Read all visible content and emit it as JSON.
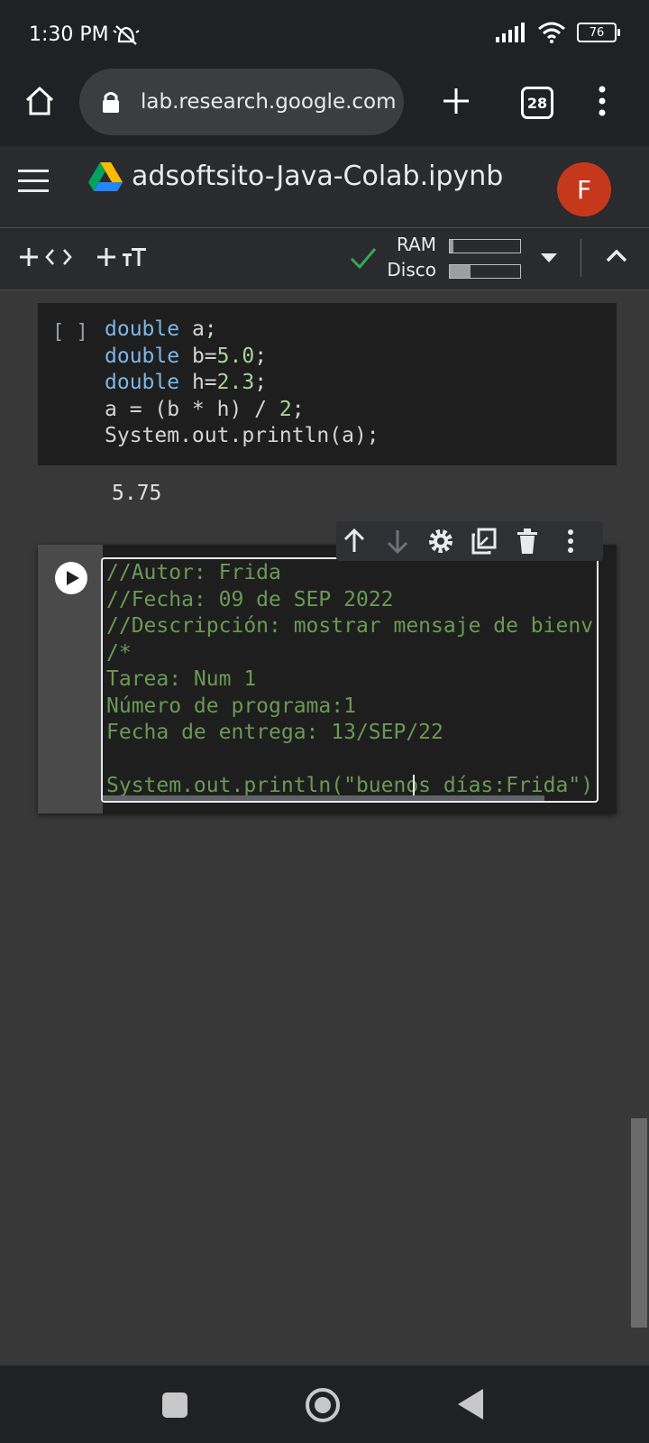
{
  "status_bar": {
    "time": "1:30 PM",
    "battery": "76"
  },
  "browser": {
    "url": "lab.research.google.com",
    "tabs_count": "28"
  },
  "colab": {
    "title": "adsoftsito-Java-Colab.ipynb",
    "avatar_letter": "F",
    "toolbar": {
      "ram_label": "RAM",
      "disk_label": "Disco",
      "ram_fraction": 0.05,
      "disk_fraction": 0.3
    }
  },
  "cell1": {
    "bracket": "[ ]",
    "lines": [
      [
        {
          "t": "double",
          "c": "kw"
        },
        {
          "t": " a;",
          "c": "plain"
        }
      ],
      [
        {
          "t": "double",
          "c": "kw"
        },
        {
          "t": " b=",
          "c": "plain"
        },
        {
          "t": "5.0",
          "c": "num"
        },
        {
          "t": ";",
          "c": "plain"
        }
      ],
      [
        {
          "t": "double",
          "c": "kw"
        },
        {
          "t": " h=",
          "c": "plain"
        },
        {
          "t": "2.3",
          "c": "num"
        },
        {
          "t": ";",
          "c": "plain"
        }
      ],
      [
        {
          "t": "a = (b * h) / ",
          "c": "plain"
        },
        {
          "t": "2",
          "c": "num"
        },
        {
          "t": ";",
          "c": "plain"
        }
      ],
      [
        {
          "t": "System.out.println(a);",
          "c": "plain"
        }
      ]
    ],
    "output": "5.75"
  },
  "cell2": {
    "lines": [
      "//Autor: Frida",
      "//Fecha: 09 de SEP 2022",
      "//Descripción: mostrar mensaje de bienv",
      "/*",
      "Tarea: Num 1",
      "Número de programa:1",
      "Fecha de entrega: 13/SEP/22",
      "",
      "System.out.println(\"buenos días:Frida\")"
    ]
  }
}
